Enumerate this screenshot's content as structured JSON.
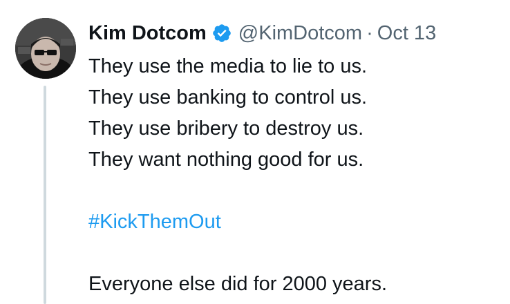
{
  "tweet": {
    "author": {
      "display_name": "Kim Dotcom",
      "handle": "@KimDotcom",
      "verified": true,
      "avatar_icon": "kim-dotcom-avatar"
    },
    "separator": "·",
    "date": "Oct 13",
    "lines": [
      "They use the media to lie to us.",
      "They use banking to control us.",
      "They use bribery to destroy us.",
      "They want nothing good for us."
    ],
    "hashtag": "#KickThemOut",
    "closing_line": "Everyone else did for 2000 years."
  },
  "colors": {
    "text": "#0f1419",
    "secondary": "#536471",
    "link": "#1d9bf0",
    "verified": "#1d9bf0",
    "thread_line": "#cfd9de"
  }
}
